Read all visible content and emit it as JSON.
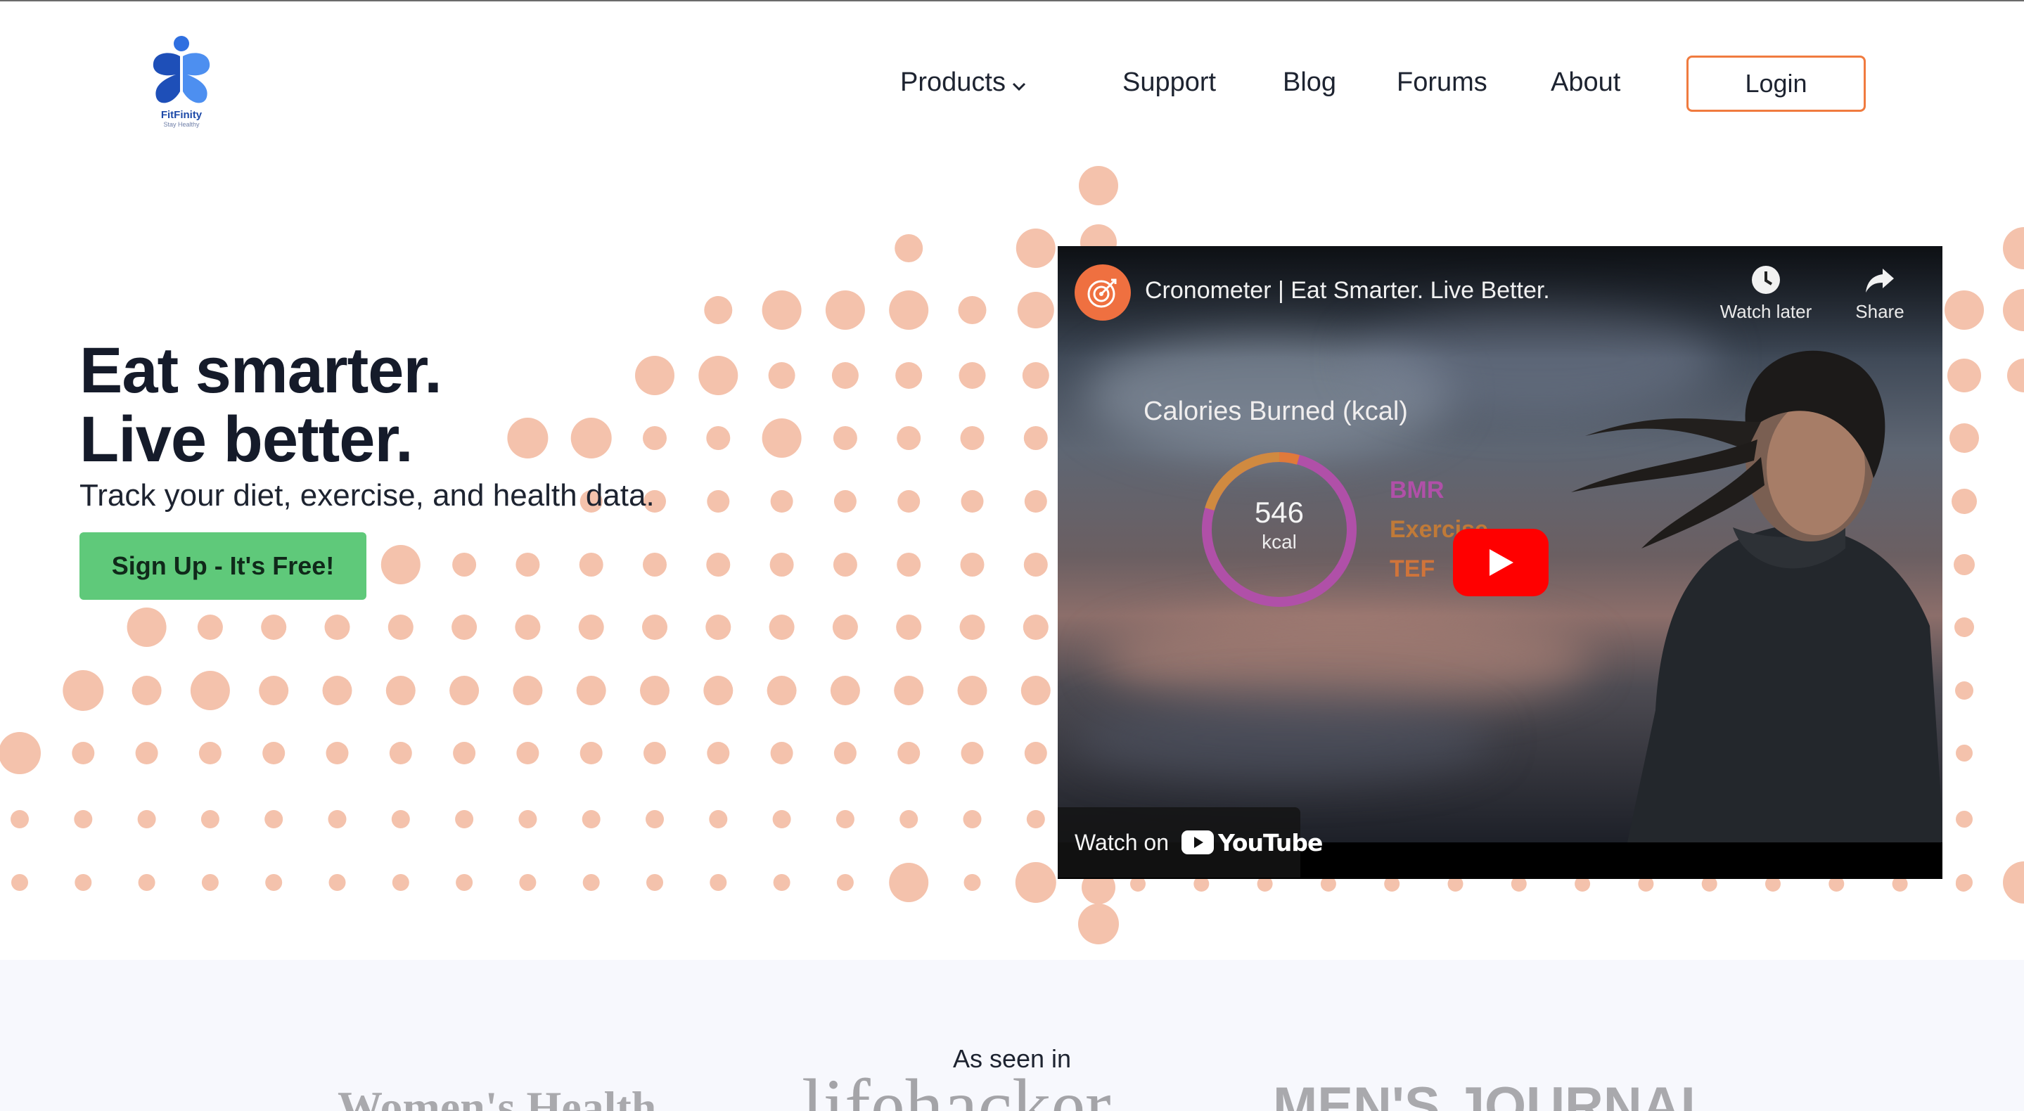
{
  "brand": {
    "name": "FitFinity",
    "tagline": "Stay Healthy"
  },
  "nav": {
    "items": [
      {
        "label": "Products",
        "has_dropdown": true
      },
      {
        "label": "Support"
      },
      {
        "label": "Blog"
      },
      {
        "label": "Forums"
      },
      {
        "label": "About"
      }
    ],
    "login_label": "Login"
  },
  "hero": {
    "title_line1": "Eat smarter.",
    "title_line2": "Live better.",
    "subtitle": "Track your diet, exercise, and health data.",
    "cta_label": "Sign Up - It's Free!"
  },
  "video": {
    "title": "Cronometer | Eat Smarter. Live Better.",
    "watch_later_label": "Watch later",
    "share_label": "Share",
    "overlay_heading": "Calories Burned (kcal)",
    "ring_value": "546",
    "ring_unit": "kcal",
    "legend": [
      {
        "label": "BMR",
        "color": "#b050a8"
      },
      {
        "label": "Exercise",
        "color": "#e08a3a"
      },
      {
        "label": "TEF",
        "color": "#e07a3a"
      }
    ],
    "watch_on_label": "Watch on",
    "youtube_label": "YouTube"
  },
  "press": {
    "label": "As seen in",
    "logos": [
      "Women's Health",
      "lifehacker",
      "MEN'S JOURNAL"
    ]
  },
  "colors": {
    "dot": "#f4c2ac",
    "accent": "#f07b3f",
    "cta": "#5fc97a",
    "brand_blue": "#2f6fe0"
  }
}
